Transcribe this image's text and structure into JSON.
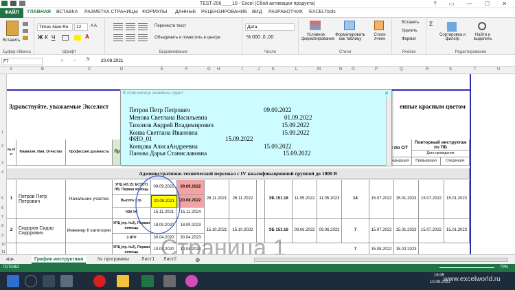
{
  "window": {
    "title": "TEST-206____10 - Excel (Сбой активации продукта)",
    "controls": "? ▭ — ☐ ✕"
  },
  "tabs": [
    "ФАЙЛ",
    "ГЛАВНАЯ",
    "ВСТАВКА",
    "РАЗМЕТКА СТРАНИЦЫ",
    "ФОРМУЛЫ",
    "ДАННЫЕ",
    "РЕЦЕНЗИРОВАНИЕ",
    "ВИД",
    "РАЗРАБОТЧИК",
    "EXCELTools"
  ],
  "ribbon": {
    "paste": "Вставить",
    "clipboard": "Буфер обмена",
    "font_name": "Times New Ro",
    "font_size": "12",
    "font_group": "Шрифт",
    "wrap_text": "Перенести текст",
    "merge_center": "Объединить и поместить в центре",
    "alignment": "Выравнивание",
    "number_format": "Дата",
    "number": "Число",
    "cond_format": "Условное форматирование",
    "format_table": "Форматировать как таблицу",
    "cell_styles": "Стили ячеек",
    "styles": "Стили",
    "insert": "Вставить",
    "delete": "Удалить",
    "format": "Формат",
    "cells": "Ячейки",
    "sort_filter": "Сортировка и фильтр",
    "find_select": "Найти и выделить",
    "editing": "Редактирование"
  },
  "formula_bar": {
    "name_box": "F7",
    "fx": "fx",
    "value": "20.08.2021"
  },
  "columns": [
    "A",
    "B",
    "C",
    "D",
    "E",
    "F",
    "G",
    "H",
    "I",
    "J",
    "K",
    "L",
    "M",
    "N",
    "O",
    "P",
    "Q",
    "R",
    "S",
    "T",
    "U"
  ],
  "rows": [
    "1",
    "2",
    "3",
    "4",
    "5",
    "6",
    "7",
    "8",
    "9",
    "10",
    "11"
  ],
  "sheet": {
    "greeting": "Здравствуйте, уважаемые Экселист",
    "greeting_tail": "енные красным цветом",
    "hdr_num": "№ п/п",
    "hdr_name": "Фамилия, Имя, Отчество",
    "hdr_prof": "Профессия/ должность",
    "hdr_pr": "Пр",
    "hdr_ot": "ж по ОТ",
    "hdr_pb": "Повторный инструктаж по ПБ",
    "hdr_date": "Дата проведения",
    "hdr_prev": "Предыдущая",
    "hdr_next": "Следующая",
    "section": "Административно-технический персонал с IV квалификационной группой до 1000 В",
    "r1_num": "1",
    "r1_name": "Петров Петр Петрович",
    "r1_prof": "Начальник участка",
    "r1_a": "УПЦ (43.15; ЕСУОТ) ПБ; Первая помощь",
    "r1_b": "Высота 3 гр.",
    "r1_c": "ЧЭК УС",
    "r1_a_prev": "09.09.2021",
    "r1_a_next": "09.09.2022",
    "r1_b_prev": "20.08.2021",
    "r1_b_next": "20.08.2022",
    "r1_c_prev": "15.11.2021",
    "r1_c_next": "15.11.2024",
    "r1_h": "26.11.2021",
    "r1_i": "26.11.2022",
    "r1_k": "ЭБ 151.16",
    "r1_l": "11.05.2022",
    "r1_m": "11.05.2023",
    "r1_n": "14",
    "r1_o": "15.07.2022",
    "r1_p": "15.01.2023",
    "r1_q": "15.07.2022",
    "r1_r": "15.01.2023",
    "r2_num": "2",
    "r2_name": "Сидоров Сидор Сидорович",
    "r2_prof": "Инженер II категории",
    "r2_a": "УПЦ (пр. №2), Первая помощь",
    "r2_b": "3 ИТР",
    "r2_a_prev": "18.09.2020",
    "r2_a_next": "18.09.2023",
    "r2_b_prev": "30.04.2020",
    "r2_b_next": "30.04.2023",
    "r2_h": "15.10.2021",
    "r2_i": "15.10.2022",
    "r2_k": "ЭБ 151.16",
    "r2_l": "09.06.2022",
    "r2_m": "09.06.2023",
    "r2_n": "7",
    "r2_o": "15.07.2022",
    "r2_p": "15.01.2023",
    "r2_q": "15.07.2022",
    "r2_r": "15.01.2023",
    "r3_a": "УПЦ (пр. №2), Первая помощь",
    "r3_a_prev": "10.04.2020",
    "r3_a_next": "10.04.2023",
    "r3_n": "7",
    "r3_o": "15.08.2022",
    "r3_p": "15.02.2023"
  },
  "popup": {
    "title": "В этом месяце экзамены сдают",
    "lines": [
      {
        "name": "Петров Петр Петрович",
        "date": "09.09.2022"
      },
      {
        "name": "Менова Светлана Васильевна",
        "date": "01.09.2022"
      },
      {
        "name": "Тихонов Андрей Владимирович",
        "date": "15.09.2022"
      },
      {
        "name": "Конва Светлана Ивановна",
        "date": "15.09.2022"
      },
      {
        "name": "ФИО_01",
        "date": "15.09.2022"
      },
      {
        "name": "Концова АлисаАндреевна",
        "date": "15.09.2022"
      },
      {
        "name": "Панова Дарья Станиславовна",
        "date": "15.09.2022"
      }
    ]
  },
  "sheet_tabs": [
    "График инструктажа",
    "№ программы",
    "Лист1",
    "Лист2"
  ],
  "status": {
    "ready": "ГОТОВО",
    "zoom": "70%"
  },
  "taskbar": {
    "time": "15:05",
    "date": "10.09.2022",
    "site": "www.excelworld.ru"
  },
  "watermark": "Страница 1"
}
